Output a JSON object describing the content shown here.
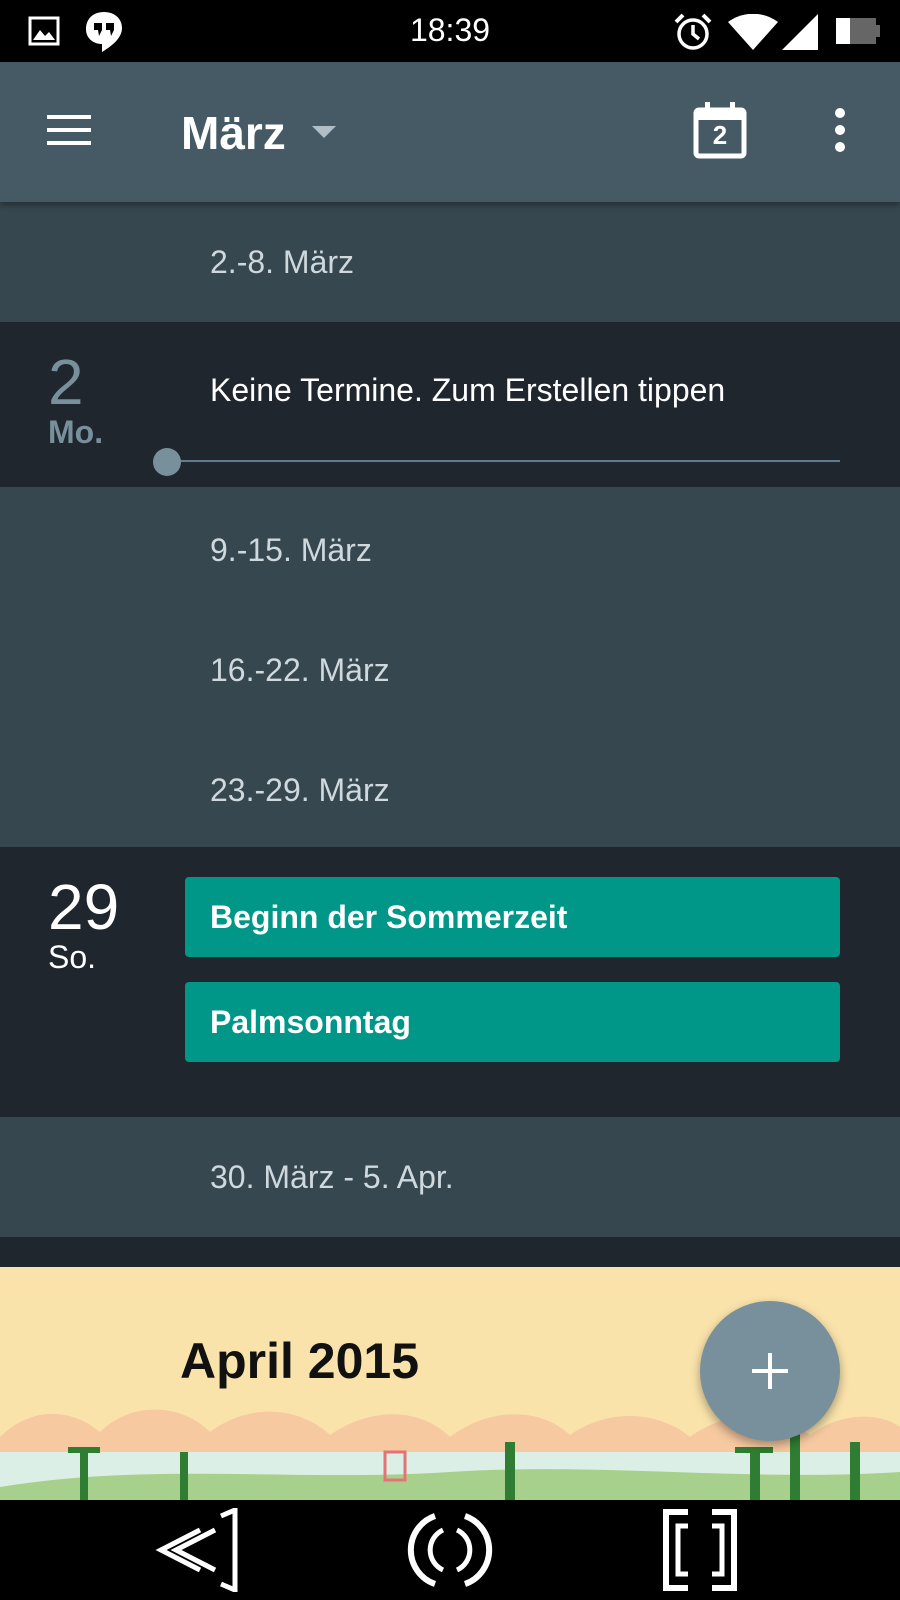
{
  "status_bar": {
    "time": "18:39"
  },
  "toolbar": {
    "title": "März",
    "today_icon_day": "2"
  },
  "agenda": {
    "week_1": "2.-8. März",
    "day_2": {
      "number": "2",
      "weekday": "Mo.",
      "empty_text": "Keine Termine. Zum Erstellen tippen"
    },
    "week_2": "9.-15. März",
    "week_3": "16.-22. März",
    "week_4": "23.-29. März",
    "day_29": {
      "number": "29",
      "weekday": "So.",
      "events": [
        "Beginn der Sommerzeit",
        "Palmsonntag"
      ]
    },
    "week_5": "30. März - 5. Apr."
  },
  "month_banner": {
    "label": "April 2015"
  },
  "colors": {
    "toolbar": "#455a64",
    "week_bg": "#37474f",
    "day_bg": "#1f262d",
    "event": "#009688",
    "fab": "#78909c",
    "banner": "#fae3ab"
  },
  "icons": [
    "gallery-icon",
    "hangouts-icon",
    "alarm-icon",
    "wifi-icon",
    "signal-icon",
    "battery-icon",
    "menu-icon",
    "dropdown-arrow-icon",
    "calendar-today-icon",
    "overflow-menu-icon",
    "add-icon",
    "back-icon",
    "home-icon",
    "recents-icon"
  ]
}
